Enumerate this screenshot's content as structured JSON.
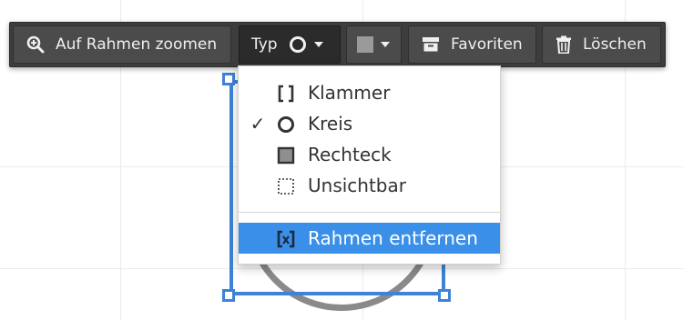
{
  "toolbar": {
    "zoom_label": "Auf Rahmen zoomen",
    "type_label": "Typ",
    "favorites_label": "Favoriten",
    "delete_label": "Löschen",
    "color_value": "#9a9a9a"
  },
  "menu": {
    "items": [
      {
        "label": "Klammer",
        "icon": "bracket-icon",
        "checked": false
      },
      {
        "label": "Kreis",
        "icon": "circle-outline-icon",
        "checked": true,
        "check_mark": "✓"
      },
      {
        "label": "Rechteck",
        "icon": "filled-square-icon",
        "checked": false
      },
      {
        "label": "Unsichtbar",
        "icon": "dotted-square-icon",
        "checked": false
      }
    ],
    "remove_label": "Rahmen entfernen",
    "remove_icon": "bracket-x-icon"
  },
  "colors": {
    "toolbar_bg": "#3d3d3d",
    "accent_blue": "#3d83d6",
    "highlight_blue": "#3a8fe8"
  }
}
